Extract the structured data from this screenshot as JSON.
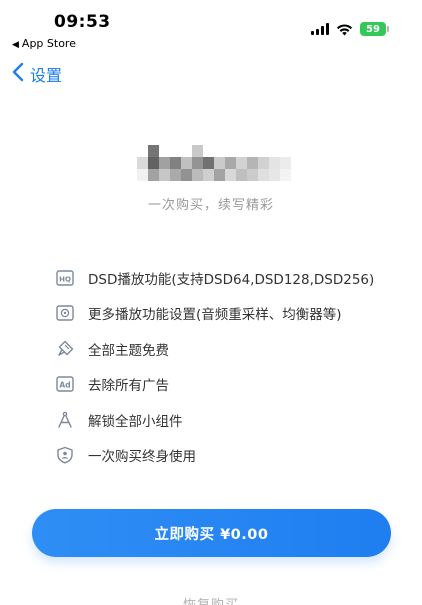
{
  "status_bar": {
    "time": "09:53",
    "back_app": "App Store",
    "battery": "59"
  },
  "nav": {
    "back_label": "设置"
  },
  "hero": {
    "tagline": "一次购买，续写精彩"
  },
  "features": [
    {
      "icon": "hq-icon",
      "text": "DSD播放功能(支持DSD64,DSD128,DSD256)"
    },
    {
      "icon": "speaker-icon",
      "text": "更多播放功能设置(音频重采样、均衡器等)"
    },
    {
      "icon": "brush-icon",
      "text": "全部主题免费"
    },
    {
      "icon": "ad-icon",
      "text": "去除所有广告"
    },
    {
      "icon": "compass-icon",
      "text": "解锁全部小组件"
    },
    {
      "icon": "shield-user-icon",
      "text": "一次购买终身使用"
    }
  ],
  "buy_button": {
    "label": "立即购买 ¥0.00"
  },
  "restore": {
    "label": "恢复购买"
  },
  "colors": {
    "accent": "#1e7cf2",
    "battery": "#34c759",
    "muted_text": "#9a9a9a"
  }
}
